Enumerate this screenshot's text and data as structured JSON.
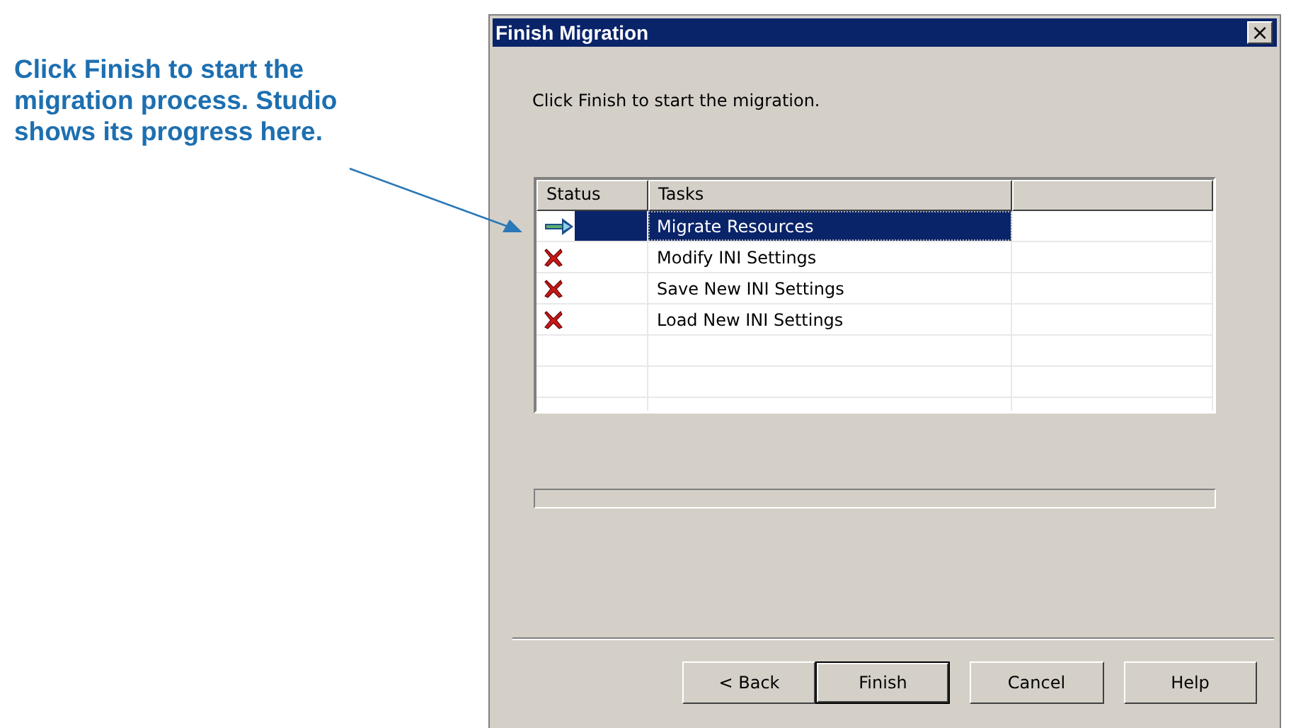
{
  "callout": {
    "text": "Click Finish to start the migration process. Studio shows its progress here."
  },
  "dialog": {
    "title": "Finish Migration",
    "close_glyph": "×",
    "instruction": "Click Finish to start the migration.",
    "table": {
      "columns": [
        "Status",
        "Tasks",
        ""
      ],
      "rows": [
        {
          "kind": "current",
          "task": "Migrate Resources",
          "selected": true
        },
        {
          "kind": "failed",
          "task": "Modify INI Settings",
          "selected": false
        },
        {
          "kind": "failed",
          "task": "Save New INI Settings",
          "selected": false
        },
        {
          "kind": "failed",
          "task": "Load New INI Settings",
          "selected": false
        }
      ]
    },
    "progress": {
      "level": 0
    },
    "buttons": [
      {
        "label": "< Back",
        "default": false
      },
      {
        "label": "Finish",
        "default": true
      },
      {
        "label": "Cancel",
        "default": false
      },
      {
        "label": "Help",
        "default": false
      }
    ]
  }
}
